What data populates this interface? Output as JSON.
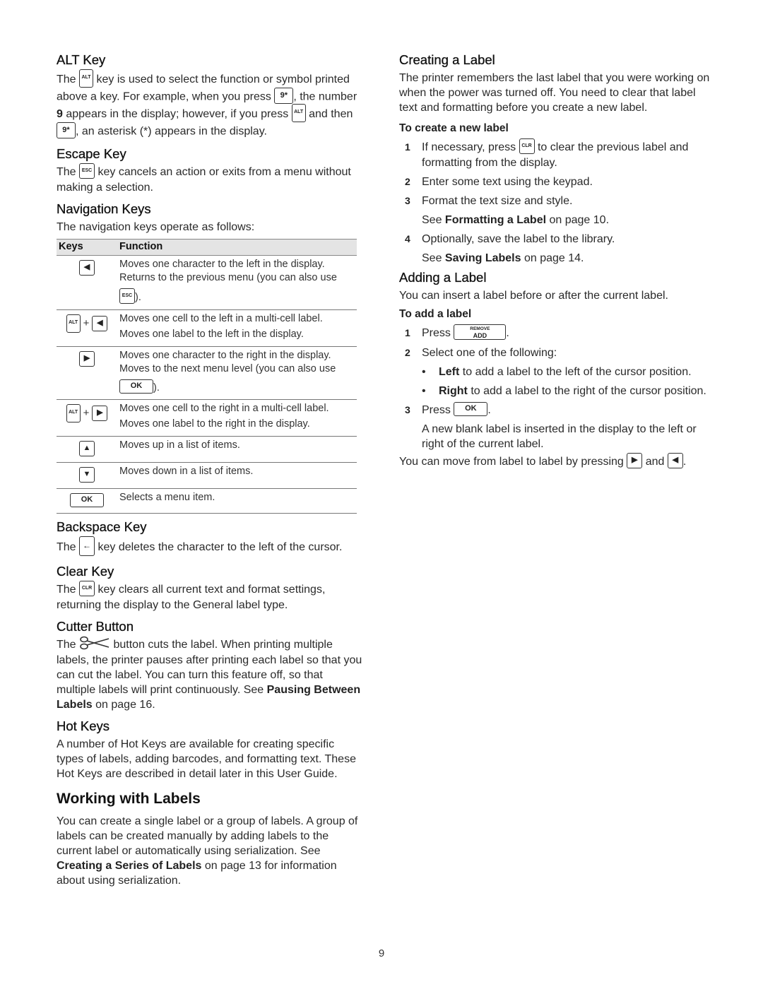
{
  "page_number": "9",
  "left": {
    "alt_key": {
      "heading": "ALT Key",
      "t1": "The",
      "key_alt": "ALT",
      "t2": " key is used to select the function or symbol printed above a key. For example, when you press ",
      "key_9": "9*",
      "t3": ", the number ",
      "bold_9": "9",
      "t4": " appears in the display; however, if you press ",
      "t5": " and then ",
      "t6": ", an asterisk (*) appears in the display."
    },
    "escape_key": {
      "heading": "Escape Key",
      "t1": "The",
      "key_esc": "ESC",
      "t2": " key cancels an action or exits from a menu without making a selection."
    },
    "navigation_keys": {
      "heading": "Navigation Keys",
      "intro": "The navigation keys operate as follows:",
      "table": {
        "headers": [
          "Keys",
          "Function"
        ],
        "rows": [
          {
            "keys": [
              "left-arrow"
            ],
            "lines": [
              "Moves one character to the left in the display.",
              "Returns to the previous menu (you can also use"
            ],
            "tail_key": "ESC",
            "tail_text": ")."
          },
          {
            "keys": [
              "ALT",
              "+",
              "left-arrow"
            ],
            "lines": [
              "Moves one cell to the left in a multi-cell label.",
              "Moves one label to the left in the display."
            ]
          },
          {
            "keys": [
              "right-arrow"
            ],
            "lines": [
              "Moves one character to the right in the display.",
              "Moves to the next menu level (you can also use"
            ],
            "tail_key": "OK",
            "tail_text": ")."
          },
          {
            "keys": [
              "ALT",
              "+",
              "right-arrow"
            ],
            "lines": [
              "Moves one cell to the right in a multi-cell label.",
              "Moves one label to the right in the display."
            ]
          },
          {
            "keys": [
              "up-arrow"
            ],
            "lines": [
              "Moves up in a list of items."
            ]
          },
          {
            "keys": [
              "down-arrow"
            ],
            "lines": [
              "Moves down in a list of items."
            ]
          },
          {
            "keys": [
              "OK"
            ],
            "lines": [
              "Selects a menu item."
            ]
          }
        ]
      }
    },
    "backspace_key": {
      "heading": "Backspace Key",
      "t1": "The",
      "key_glyph": "←",
      "t2": " key deletes the character to the left of the cursor."
    },
    "clear_key": {
      "heading": "Clear Key",
      "t1": "The",
      "key_clr": "CLR",
      "t2": " key clears all current text and format settings, returning the display to the General label type."
    },
    "cutter_button": {
      "heading": "Cutter Button",
      "t1": "The",
      "t2": " button cuts the label. When printing multiple labels, the printer pauses after printing each label so that you can cut the label. You can turn this feature off, so that multiple labels will print continuously. See ",
      "link": "Pausing Between Labels",
      "t3": " on page 16."
    },
    "hot_keys": {
      "heading": "Hot Keys",
      "body": "A number of Hot Keys are available for creating specific types of labels, adding barcodes, and formatting text. These Hot Keys are described in detail later in this User Guide."
    },
    "working_with_labels": {
      "heading": "Working with Labels",
      "t1": "You can create a single label or a group of labels. A group of labels can be created manually by adding labels to the current label or automatically using serialization. See ",
      "link": "Creating a Series of Labels",
      "t2": " on page 13 for information about using serialization."
    }
  },
  "right": {
    "creating_label": {
      "heading": "Creating a Label",
      "body": "The printer remembers the last label that you were working on when the power was turned off. You need to clear that label text and formatting before you create a new label.",
      "subheading": "To create a new label",
      "steps": [
        {
          "num": "1",
          "t1": "If necessary, press ",
          "key": "CLR",
          "t2": " to clear the previous label and formatting from the display."
        },
        {
          "num": "2",
          "text": "Enter some text using the keypad."
        },
        {
          "num": "3",
          "text": "Format the text size and style.",
          "see_pre": "See ",
          "see_link": "Formatting a Label",
          "see_post": " on page 10."
        },
        {
          "num": "4",
          "text": "Optionally, save the label to the library.",
          "see_pre": "See ",
          "see_link": "Saving Labels",
          "see_post": " on page 14."
        }
      ]
    },
    "adding_label": {
      "heading": "Adding a Label",
      "body": "You can insert a label before or after the current label.",
      "subheading": "To add a label",
      "step1": {
        "num": "1",
        "t1": "Press ",
        "key_top": "REMOVE",
        "key_bottom": "ADD",
        "t2": "."
      },
      "step2": {
        "num": "2",
        "text": "Select one of the following:",
        "bullets": [
          {
            "bold": "Left",
            "text": " to add a label to the left of the cursor position."
          },
          {
            "bold": "Right",
            "text": " to add a label to the right of the cursor position."
          }
        ]
      },
      "step3": {
        "num": "3",
        "t1": "Press ",
        "key": "OK",
        "t2": ".",
        "result": "A new blank label is inserted in the display to the left or right of the current label."
      },
      "footer": {
        "t1": "You can move from label to label by pressing ",
        "t2": " and ",
        "t3": "."
      }
    }
  }
}
